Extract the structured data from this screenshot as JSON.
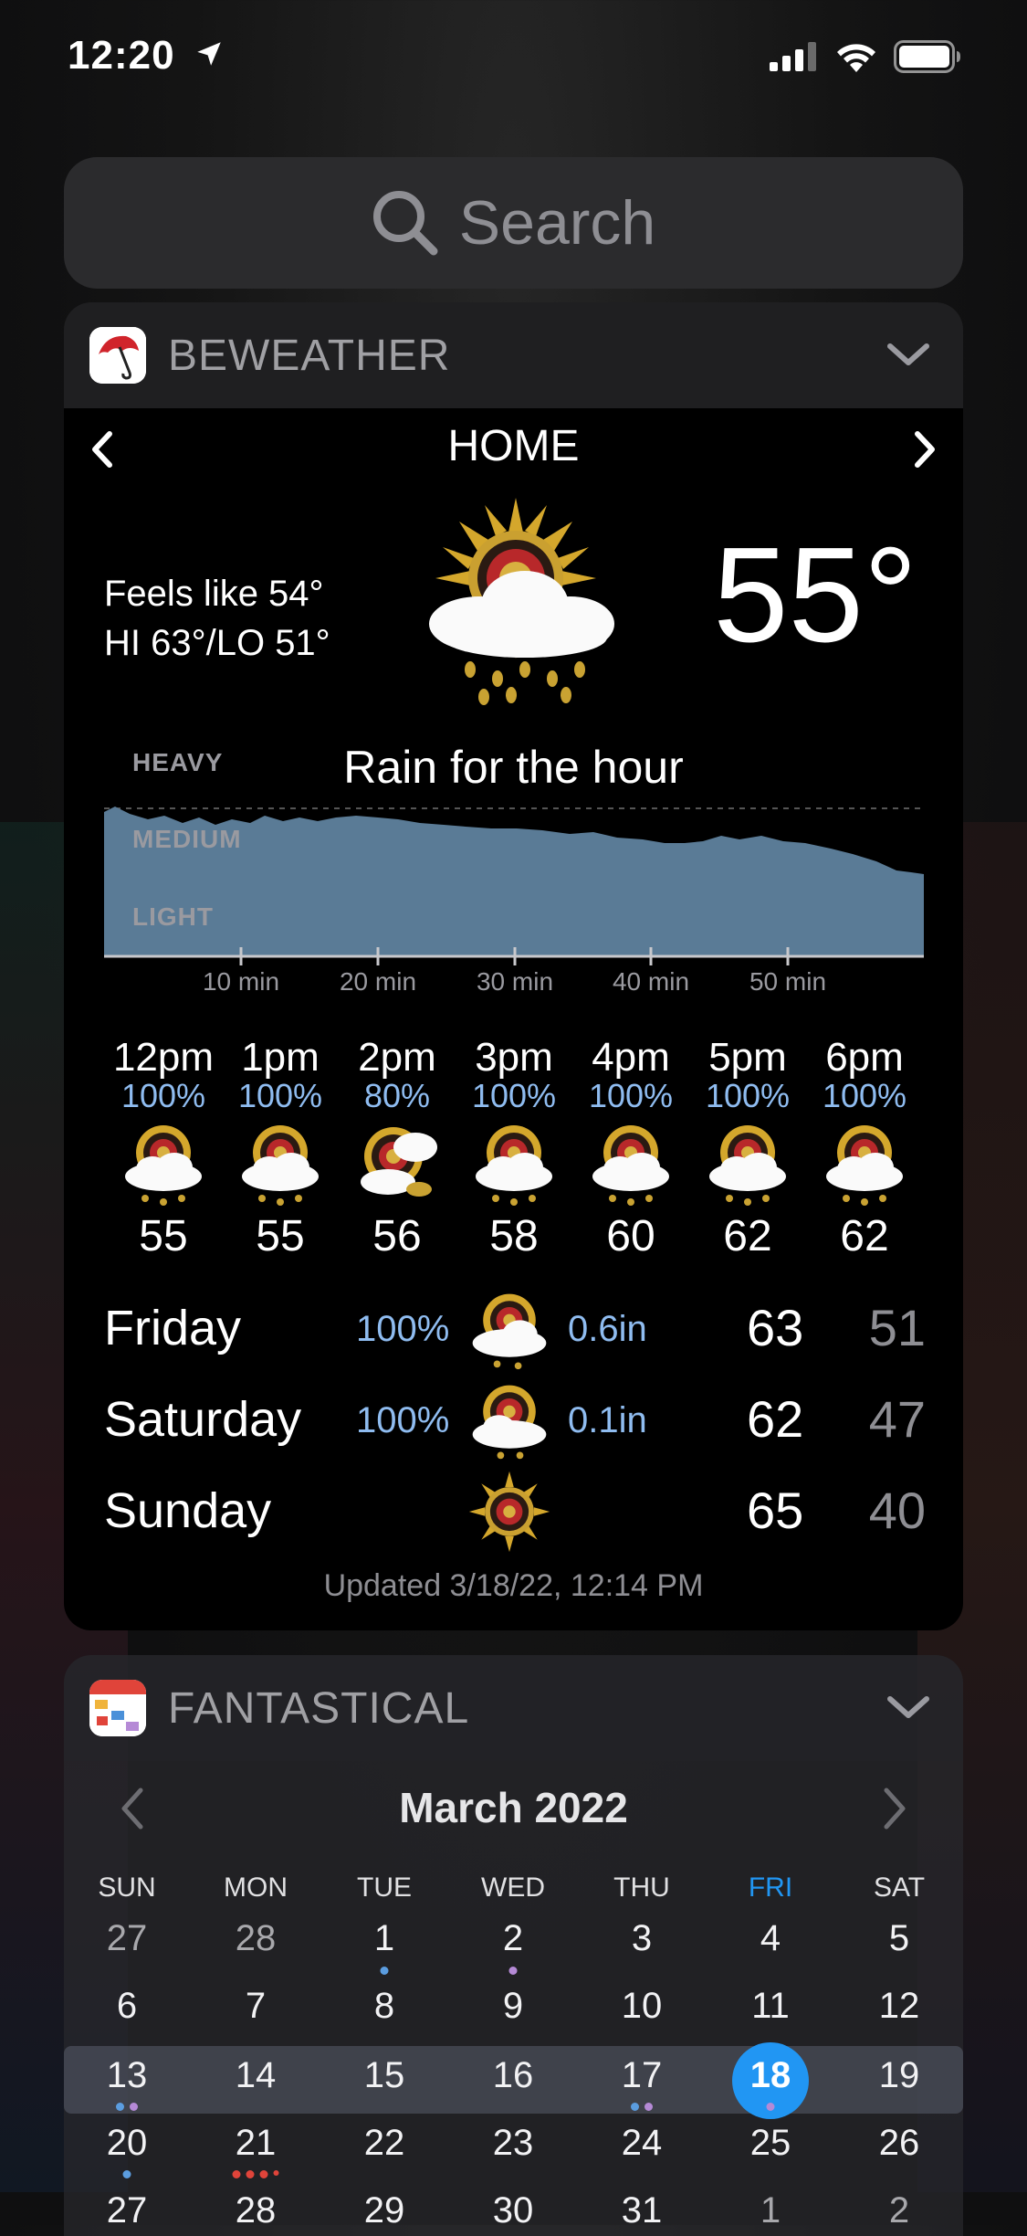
{
  "status": {
    "time": "12:20"
  },
  "search": {
    "placeholder": "Search"
  },
  "beweather": {
    "app_name": "BEWEATHER",
    "location": "HOME",
    "feels_like": "Feels like 54°",
    "hi_lo": "HI 63°/LO 51°",
    "temperature": "55°",
    "rain": {
      "title": "Rain for the hour",
      "levels": [
        "HEAVY",
        "MEDIUM",
        "LIGHT"
      ],
      "ticks": [
        "10 min",
        "20 min",
        "30 min",
        "40 min",
        "50 min"
      ]
    },
    "hourly": [
      {
        "time": "12pm",
        "precip": "100%",
        "temp": "55"
      },
      {
        "time": "1pm",
        "precip": "100%",
        "temp": "55"
      },
      {
        "time": "2pm",
        "precip": "80%",
        "temp": "56"
      },
      {
        "time": "3pm",
        "precip": "100%",
        "temp": "58"
      },
      {
        "time": "4pm",
        "precip": "100%",
        "temp": "60"
      },
      {
        "time": "5pm",
        "precip": "100%",
        "temp": "62"
      },
      {
        "time": "6pm",
        "precip": "100%",
        "temp": "62"
      }
    ],
    "daily": [
      {
        "day": "Friday",
        "precip": "100%",
        "amount": "0.6in",
        "hi": "63",
        "lo": "51"
      },
      {
        "day": "Saturday",
        "precip": "100%",
        "amount": "0.1in",
        "hi": "62",
        "lo": "47"
      },
      {
        "day": "Sunday",
        "precip": "",
        "amount": "",
        "hi": "65",
        "lo": "40"
      }
    ],
    "updated": "Updated 3/18/22, 12:14 PM"
  },
  "fantastical": {
    "app_name": "FANTASTICAL",
    "month": "March 2022",
    "weekdays": [
      "SUN",
      "MON",
      "TUE",
      "WED",
      "THU",
      "FRI",
      "SAT"
    ],
    "weeks": [
      [
        "27",
        "28",
        "1",
        "2",
        "3",
        "4",
        "5"
      ],
      [
        "6",
        "7",
        "8",
        "9",
        "10",
        "11",
        "12"
      ],
      [
        "13",
        "14",
        "15",
        "16",
        "17",
        "18",
        "19"
      ],
      [
        "20",
        "21",
        "22",
        "23",
        "24",
        "25",
        "26"
      ],
      [
        "27",
        "28",
        "29",
        "30",
        "31",
        "1",
        "2"
      ]
    ],
    "today": "18",
    "colors": {
      "accent": "#2196f3",
      "dot_blue": "#5b9de0",
      "dot_purple": "#b58ad6",
      "dot_red": "#e0443a"
    }
  }
}
